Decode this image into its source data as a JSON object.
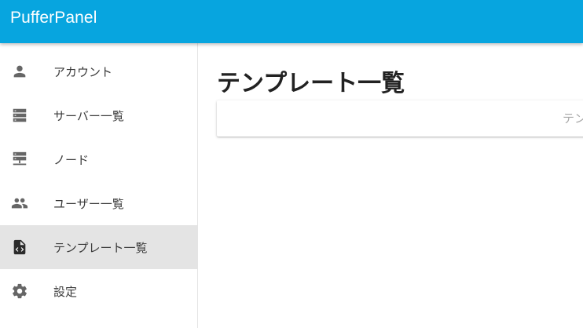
{
  "app": {
    "title": "PufferPanel",
    "accent_color": "#07a5df"
  },
  "sidebar": {
    "items": [
      {
        "label": "アカウント",
        "icon": "account-icon",
        "active": false
      },
      {
        "label": "サーバー一覧",
        "icon": "servers-icon",
        "active": false
      },
      {
        "label": "ノード",
        "icon": "nodes-icon",
        "active": false
      },
      {
        "label": "ユーザー一覧",
        "icon": "users-icon",
        "active": false
      },
      {
        "label": "テンプレート一覧",
        "icon": "template-file-icon",
        "active": true
      },
      {
        "label": "設定",
        "icon": "gear-icon",
        "active": false
      }
    ]
  },
  "main": {
    "title": "テンプレート一覧",
    "search": {
      "placeholder": "テンプレートを検索",
      "value": ""
    }
  }
}
